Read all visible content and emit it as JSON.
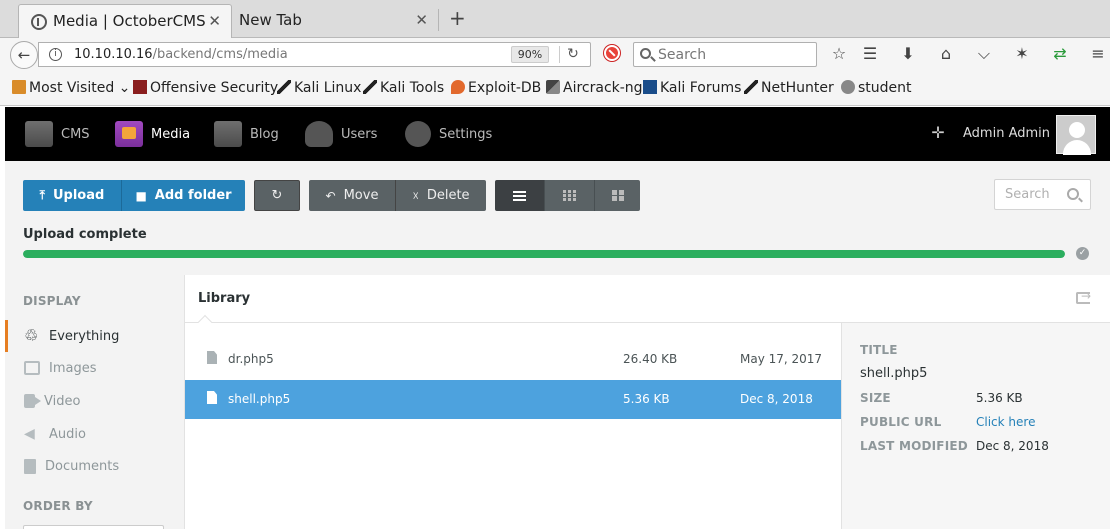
{
  "browser": {
    "tabs": [
      {
        "title": "Media | OctoberCMS",
        "active": true
      },
      {
        "title": "New Tab",
        "active": false
      }
    ],
    "close_glyph": "✕",
    "new_tab_glyph": "+",
    "url": {
      "host": "10.10.10.16",
      "path": "/backend/cms/media"
    },
    "zoom": "90%",
    "search_placeholder": "Search",
    "bookmarks": [
      {
        "label": "Most Visited",
        "icon": "folder-icon"
      },
      {
        "label": "Offensive Security",
        "icon": "offsec-icon"
      },
      {
        "label": "Kali Linux",
        "icon": "kali-dragon-icon"
      },
      {
        "label": "Kali Tools",
        "icon": "kali-dragon-icon"
      },
      {
        "label": "Exploit-DB",
        "icon": "exploit-db-icon"
      },
      {
        "label": "Aircrack-ng",
        "icon": "aircrack-icon"
      },
      {
        "label": "Kali Forums",
        "icon": "kali-forums-icon"
      },
      {
        "label": "NetHunter",
        "icon": "kali-dragon-icon"
      },
      {
        "label": "student",
        "icon": "globe-icon"
      }
    ]
  },
  "cms_nav": {
    "items": [
      {
        "label": "CMS",
        "icon": "cms-icon",
        "active": false
      },
      {
        "label": "Media",
        "icon": "media-icon",
        "active": true
      },
      {
        "label": "Blog",
        "icon": "blog-icon",
        "active": false
      },
      {
        "label": "Users",
        "icon": "users-icon",
        "active": false
      },
      {
        "label": "Settings",
        "icon": "settings-icon",
        "active": false
      }
    ],
    "user_name": "Admin Admin"
  },
  "toolbar": {
    "upload": "Upload",
    "add_folder": "Add folder",
    "move": "Move",
    "delete": "Delete",
    "search_placeholder": "Search"
  },
  "upload": {
    "status": "Upload complete",
    "progress_percent": 100,
    "color": "#2bae5e"
  },
  "sidebar": {
    "display_heading": "DISPLAY",
    "filters": [
      {
        "label": "Everything",
        "icon": "recycle-icon",
        "active": true
      },
      {
        "label": "Images",
        "icon": "image-icon",
        "active": false
      },
      {
        "label": "Video",
        "icon": "video-icon",
        "active": false
      },
      {
        "label": "Audio",
        "icon": "audio-icon",
        "active": false
      },
      {
        "label": "Documents",
        "icon": "document-icon",
        "active": false
      }
    ],
    "order_heading": "ORDER BY"
  },
  "library": {
    "title": "Library",
    "files": [
      {
        "name": "dr.php5",
        "size": "26.40 KB",
        "date": "May 17, 2017",
        "selected": false
      },
      {
        "name": "shell.php5",
        "size": "5.36 KB",
        "date": "Dec 8, 2018",
        "selected": true
      }
    ]
  },
  "details": {
    "title_label": "TITLE",
    "title_value": "shell.php5",
    "size_label": "SIZE",
    "size_value": "5.36 KB",
    "url_label": "PUBLIC URL",
    "url_value": "Click here",
    "modified_label": "LAST MODIFIED",
    "modified_value": "Dec 8, 2018"
  },
  "colors": {
    "primary": "#2581b8",
    "selected_row": "#4da2de",
    "active_filter_accent": "#e67e22",
    "nav_bg": "#000000"
  }
}
